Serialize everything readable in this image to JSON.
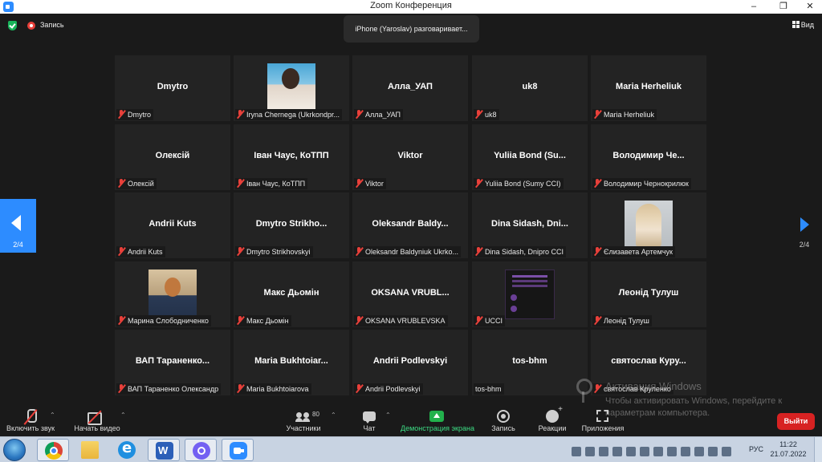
{
  "window": {
    "title": "Zoom Конференция"
  },
  "top": {
    "recording_label": "Запись",
    "active_speaker_popup": "iPhone (Yaroslav) разговаривает...",
    "view_label": "Вид"
  },
  "pager": {
    "left": "2/4",
    "right": "2/4"
  },
  "participants": [
    {
      "title": "Dmytro",
      "name": "Dmytro"
    },
    {
      "title": "",
      "name": "Iryna Chernega (Ukrkondpr..."
    },
    {
      "title": "Алла_УАП",
      "name": "Алла_УАП"
    },
    {
      "title": "uk8",
      "name": "uk8"
    },
    {
      "title": "Maria Herheliuk",
      "name": "Maria Herheliuk"
    },
    {
      "title": "Олексій",
      "name": "Олексій"
    },
    {
      "title": "Іван Чаус, КоТПП",
      "name": "Іван Чаус, КоТПП"
    },
    {
      "title": "Viktor",
      "name": "Viktor"
    },
    {
      "title": "Yuliia Bond (Su...",
      "name": "Yuliia Bond (Sumy CCI)"
    },
    {
      "title": "Володимир Че...",
      "name": "Володимир Чернокрилюк"
    },
    {
      "title": "Andrii Kuts",
      "name": "Andrii Kuts"
    },
    {
      "title": "Dmytro Strikho...",
      "name": "Dmytro Strikhovskyi"
    },
    {
      "title": "Oleksandr Baldy...",
      "name": "Oleksandr Baldyniuk Ukrko..."
    },
    {
      "title": "Dina Sidash, Dni...",
      "name": "Dina Sidash, Dnipro CCI"
    },
    {
      "title": "",
      "name": "Єлизавета Артемчук"
    },
    {
      "title": "",
      "name": "Марина Слободниченко"
    },
    {
      "title": "Макс Дьомін",
      "name": "Макс Дьомін"
    },
    {
      "title": "OKSANA VRUBL...",
      "name": "OKSANA VRUBLEVSKA"
    },
    {
      "title": "",
      "name": "UCCI"
    },
    {
      "title": "Леонід Тулуш",
      "name": "Леонід Тулуш"
    },
    {
      "title": "ВАП Тараненко...",
      "name": "ВАП Тараненко Олександр"
    },
    {
      "title": "Maria Bukhtoiar...",
      "name": "Maria Bukhtoiarova"
    },
    {
      "title": "Andrii Podlevskyi",
      "name": "Andrii Podlevskyi"
    },
    {
      "title": "tos-bhm",
      "name": "tos-bhm"
    },
    {
      "title": "святослав Куру...",
      "name": "святослав Круленко"
    }
  ],
  "watermark": {
    "title": "Активация Windows",
    "text": "Чтобы активировать Windows, перейдите к параметрам компьютера."
  },
  "toolbar": {
    "audio": "Включить звук",
    "video": "Начать видео",
    "participants": "Участники",
    "participants_count": "80",
    "chat": "Чат",
    "share": "Демонстрация экрана",
    "record": "Запись",
    "reactions": "Реакции",
    "apps": "Приложения",
    "leave": "Выйти"
  },
  "taskbar": {
    "lang": "РУС",
    "time": "11:22",
    "date": "21.07.2022"
  },
  "colors": {
    "accent": "#2d8cff",
    "muted_red": "#e8403a",
    "share_green": "#22b14c",
    "leave_red": "#d72222"
  }
}
